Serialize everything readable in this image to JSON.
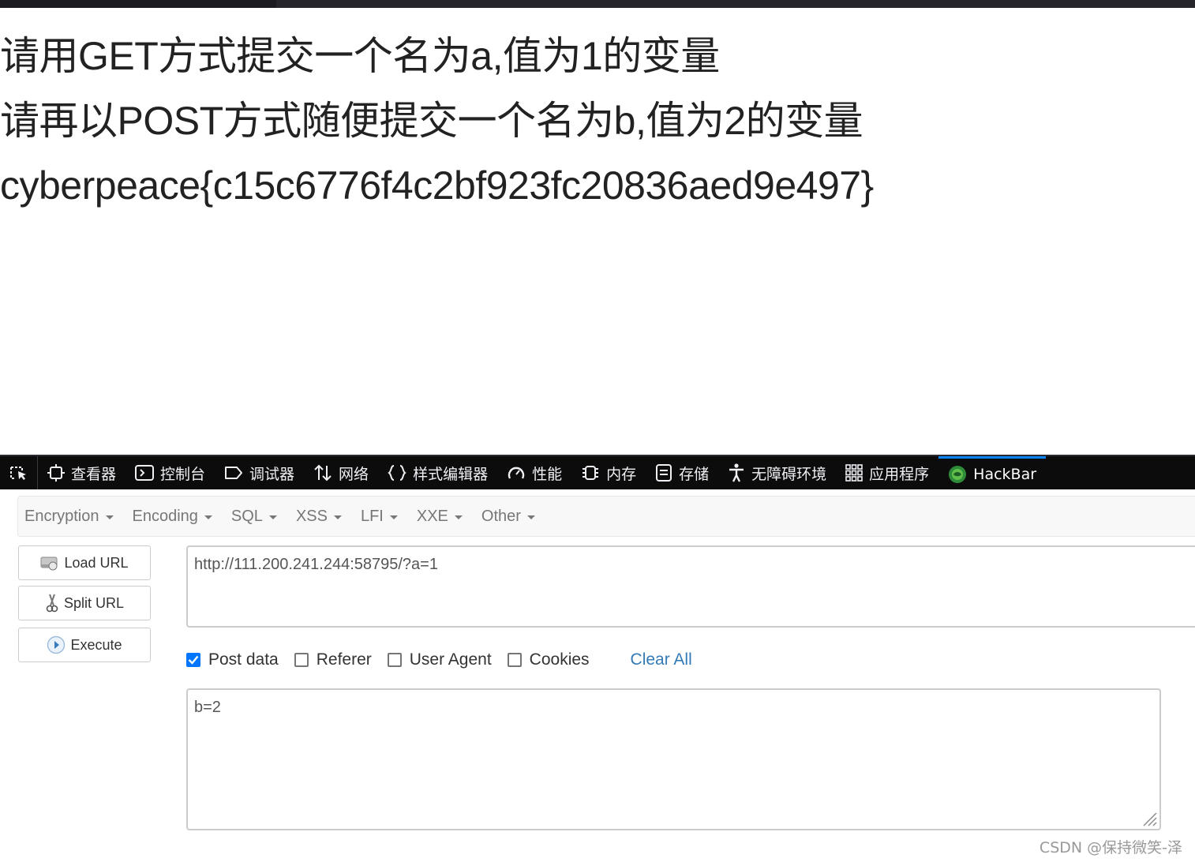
{
  "page": {
    "lines": [
      "请用GET方式提交一个名为a,值为1的变量",
      "请再以POST方式随便提交一个名为b,值为2的变量",
      "cyberpeace{c15c6776f4c2bf923fc20836aed9e497}"
    ]
  },
  "devtools": {
    "tabs": [
      {
        "label": "查看器",
        "icon": "inspector-icon"
      },
      {
        "label": "控制台",
        "icon": "console-icon"
      },
      {
        "label": "调试器",
        "icon": "debugger-icon"
      },
      {
        "label": "网络",
        "icon": "network-icon"
      },
      {
        "label": "样式编辑器",
        "icon": "style-editor-icon"
      },
      {
        "label": "性能",
        "icon": "performance-icon"
      },
      {
        "label": "内存",
        "icon": "memory-icon"
      },
      {
        "label": "存储",
        "icon": "storage-icon"
      },
      {
        "label": "无障碍环境",
        "icon": "accessibility-icon"
      },
      {
        "label": "应用程序",
        "icon": "application-icon"
      },
      {
        "label": "HackBar",
        "icon": "hackbar-icon"
      }
    ],
    "active_tab": "HackBar",
    "accent_color": "#0a84ff"
  },
  "hackbar": {
    "menus": [
      "Encryption",
      "Encoding",
      "SQL",
      "XSS",
      "LFI",
      "XXE",
      "Other"
    ],
    "buttons": {
      "load_url": "Load URL",
      "split_url": "Split URL",
      "execute": "Execute"
    },
    "url": "http://111.200.241.244:58795/?a=1",
    "options": {
      "post_data": {
        "label": "Post data",
        "checked": true
      },
      "referer": {
        "label": "Referer",
        "checked": false
      },
      "user_agent": {
        "label": "User Agent",
        "checked": false
      },
      "cookies": {
        "label": "Cookies",
        "checked": false
      },
      "clear_all": "Clear All"
    },
    "post_body": "b=2"
  },
  "watermark": "CSDN @保持微笑-泽"
}
